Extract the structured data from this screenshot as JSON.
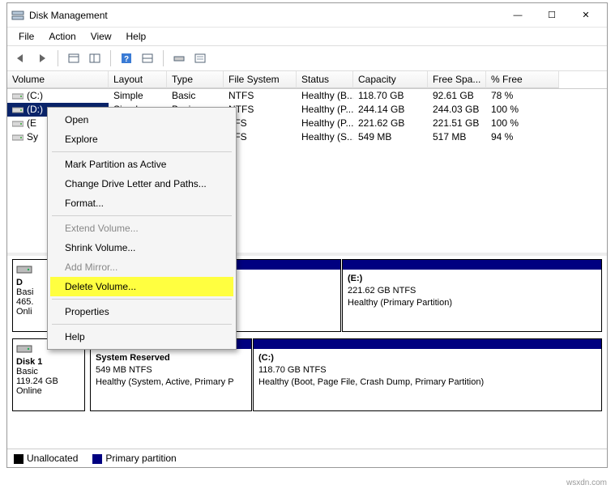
{
  "window": {
    "title": "Disk Management"
  },
  "menu": {
    "file": "File",
    "action": "Action",
    "view": "View",
    "help": "Help"
  },
  "headers": {
    "volume": "Volume",
    "layout": "Layout",
    "type": "Type",
    "fs": "File System",
    "status": "Status",
    "capacity": "Capacity",
    "free": "Free Spa...",
    "pct": "% Free"
  },
  "rows": [
    {
      "vol": "(C:)",
      "layout": "Simple",
      "type": "Basic",
      "fs": "NTFS",
      "status": "Healthy (B...",
      "cap": "118.70 GB",
      "free": "92.61 GB",
      "pct": "78 %"
    },
    {
      "vol": "(D:)",
      "layout": "Simple",
      "type": "Basic",
      "fs": "NTFS",
      "status": "Healthy (P...",
      "cap": "244.14 GB",
      "free": "244.03 GB",
      "pct": "100 %"
    },
    {
      "vol": "(E",
      "layout": "",
      "type": "",
      "fs": "TFS",
      "status": "Healthy (P...",
      "cap": "221.62 GB",
      "free": "221.51 GB",
      "pct": "100 %"
    },
    {
      "vol": "Sy",
      "layout": "",
      "type": "",
      "fs": "TFS",
      "status": "Healthy (S...",
      "cap": "549 MB",
      "free": "517 MB",
      "pct": "94 %"
    }
  ],
  "context": {
    "open": "Open",
    "explore": "Explore",
    "mark": "Mark Partition as Active",
    "change": "Change Drive Letter and Paths...",
    "format": "Format...",
    "extend": "Extend Volume...",
    "shrink": "Shrink Volume...",
    "mirror": "Add Mirror...",
    "delete": "Delete Volume...",
    "props": "Properties",
    "help": "Help"
  },
  "disk0": {
    "name": "D",
    "type": "Basi",
    "size": "465.",
    "status": "Onli",
    "partE": {
      "label": "(E:)",
      "cap": "221.62 GB NTFS",
      "status": "Healthy (Primary Partition)"
    }
  },
  "disk1": {
    "name": "Disk 1",
    "type": "Basic",
    "size": "119.24 GB",
    "status": "Online",
    "partSR": {
      "label": "System Reserved",
      "cap": "549 MB NTFS",
      "status": "Healthy (System, Active, Primary P"
    },
    "partC": {
      "label": "(C:)",
      "cap": "118.70 GB NTFS",
      "status": "Healthy (Boot, Page File, Crash Dump, Primary Partition)"
    }
  },
  "legend": {
    "unalloc": "Unallocated",
    "primary": "Primary partition"
  },
  "watermark": "wsxdn.com"
}
